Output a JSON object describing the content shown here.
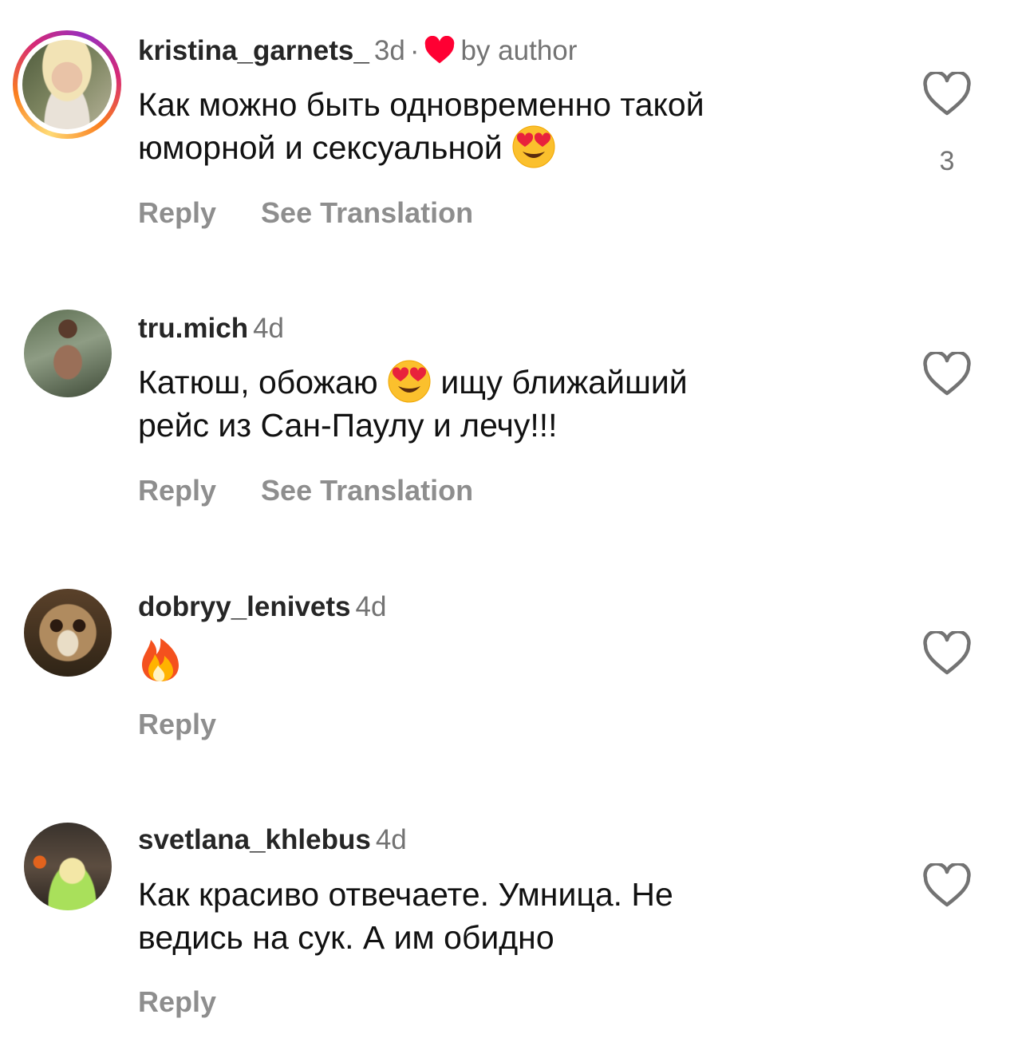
{
  "comments": [
    {
      "username": "kristina_garnets_",
      "time": "3d",
      "separator": "·",
      "liked_by_author": "by author",
      "text_line1": "Как можно быть одновременно такой",
      "text_line2": "юморной и сексуальной",
      "emoji": "heart-eyes",
      "reply_label": "Reply",
      "translation_label": "See Translation",
      "like_count": "3",
      "has_story_ring": true
    },
    {
      "username": "tru.mich",
      "time": "4d",
      "text_line1a": "Катюш, обожаю",
      "text_line1b": "ищу ближайший",
      "text_line2": "рейс из Сан-Паулу и лечу!!!",
      "emoji": "heart-eyes",
      "reply_label": "Reply",
      "translation_label": "See Translation"
    },
    {
      "username": "dobryy_lenivets",
      "time": "4d",
      "emoji": "fire",
      "reply_label": "Reply"
    },
    {
      "username": "svetlana_khlebus",
      "time": "4d",
      "text_line1": "Как красиво отвечаете. Умница. Не",
      "text_line2": "ведись на сук. А им обидно",
      "reply_label": "Reply"
    }
  ],
  "colors": {
    "username": "#262626",
    "meta": "#737373",
    "action": "#8e8e8e",
    "liked_heart": "#ff0033"
  }
}
